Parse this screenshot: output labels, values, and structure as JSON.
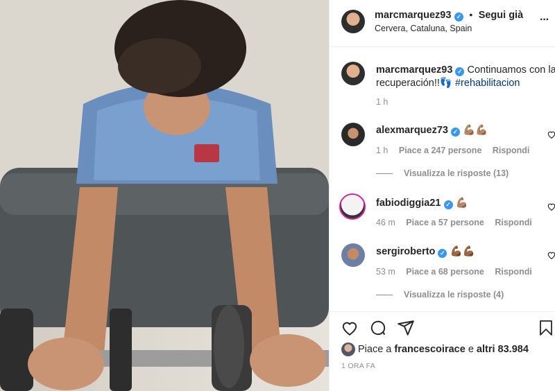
{
  "post": {
    "author": "marcmarquez93",
    "location": "Cervera, Cataluna, Spain",
    "follow_status": "Segui già",
    "bullet": "•",
    "more": "···"
  },
  "caption": {
    "author": "marcmarquez93",
    "text": "Continuamos con la recuperación!!👣",
    "hashtag": "#rehabilitacion",
    "time": "1 h"
  },
  "comments": [
    {
      "author": "alexmarquez73",
      "text": "💪🏽💪🏽",
      "time": "1 h",
      "likes": "Piace a 247 persone",
      "reply": "Rispondi",
      "view_replies": "Visualizza le risposte (13)"
    },
    {
      "author": "fabiodiggia21",
      "text": "💪🏽",
      "time": "46 m",
      "likes": "Piace a 57 persone",
      "reply": "Rispondi"
    },
    {
      "author": "sergiroberto",
      "text": "💪🏾💪🏾",
      "time": "53 m",
      "likes": "Piace a 68 persone",
      "reply": "Rispondi",
      "view_replies": "Visualizza le risposte (4)"
    }
  ],
  "likes_summary": {
    "prefix": "Piace a",
    "user": "francescoirace",
    "connector": "e",
    "others": "altri 83.984"
  },
  "timestamp": "1 ORA FA",
  "colors": {
    "verified": "#3897f0",
    "link": "#00376b",
    "muted": "#8e8e8e"
  },
  "icons": [
    "heart-icon",
    "comment-icon",
    "share-icon",
    "bookmark-icon",
    "more-options-icon",
    "verified-badge-icon"
  ]
}
